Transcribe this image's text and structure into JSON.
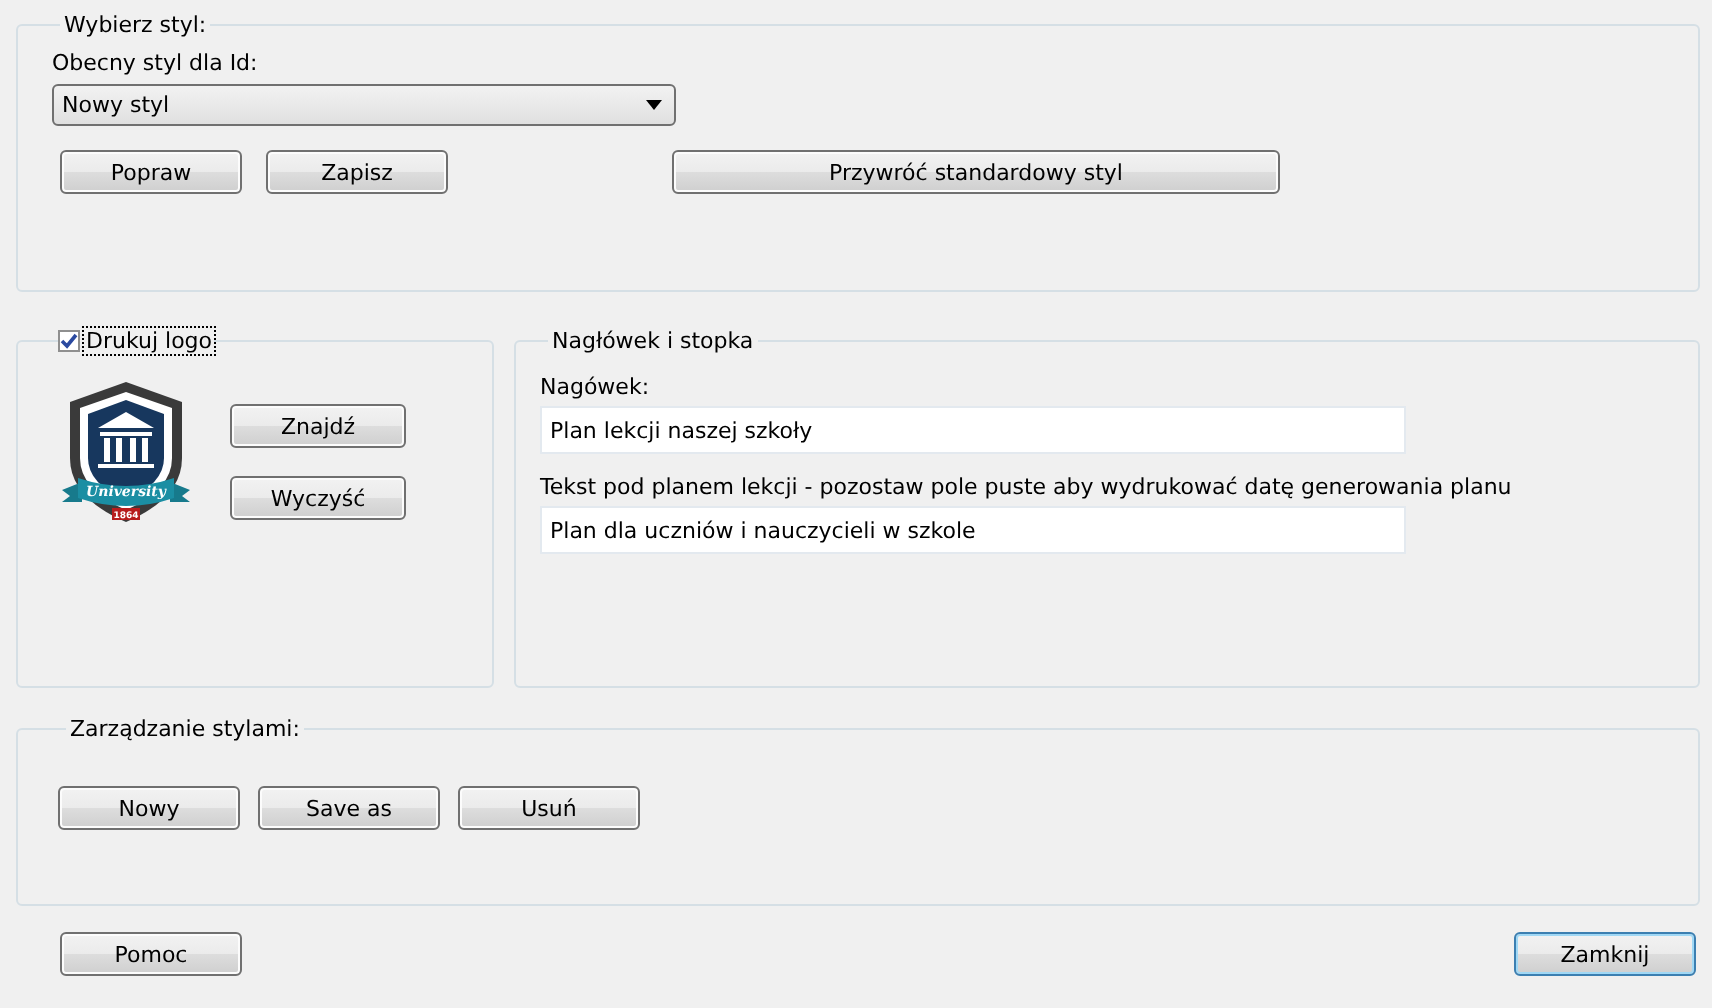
{
  "style_group": {
    "title": "Wybierz styl:",
    "current_label": "Obecny styl dla Id:",
    "current_value": "Nowy styl",
    "buttons": [
      "Popraw",
      "Zapisz"
    ],
    "reset_button": "Przywróć standardowy styl"
  },
  "logo_group": {
    "print_logo": {
      "label": "Drukuj logo",
      "checked": true
    },
    "logo": {
      "ribbon": "University",
      "year": "1864"
    },
    "buttons": [
      "Znajdź",
      "Wyczyść"
    ]
  },
  "header_footer": {
    "title": "Nagłówek i stopka",
    "fields": [
      {
        "label": "Nagówek:",
        "value": "Plan lekcji naszej szkoły"
      },
      {
        "label": "Tekst pod planem lekcji - pozostaw pole puste aby wydrukować datę generowania planu",
        "value": "Plan dla uczniów i nauczycieli w szkole"
      }
    ]
  },
  "manage_group": {
    "title": "Zarządzanie stylami:",
    "buttons": [
      "Nowy",
      "Save as",
      "Usuń"
    ]
  },
  "footer": {
    "help": "Pomoc",
    "close": "Zamknij"
  }
}
